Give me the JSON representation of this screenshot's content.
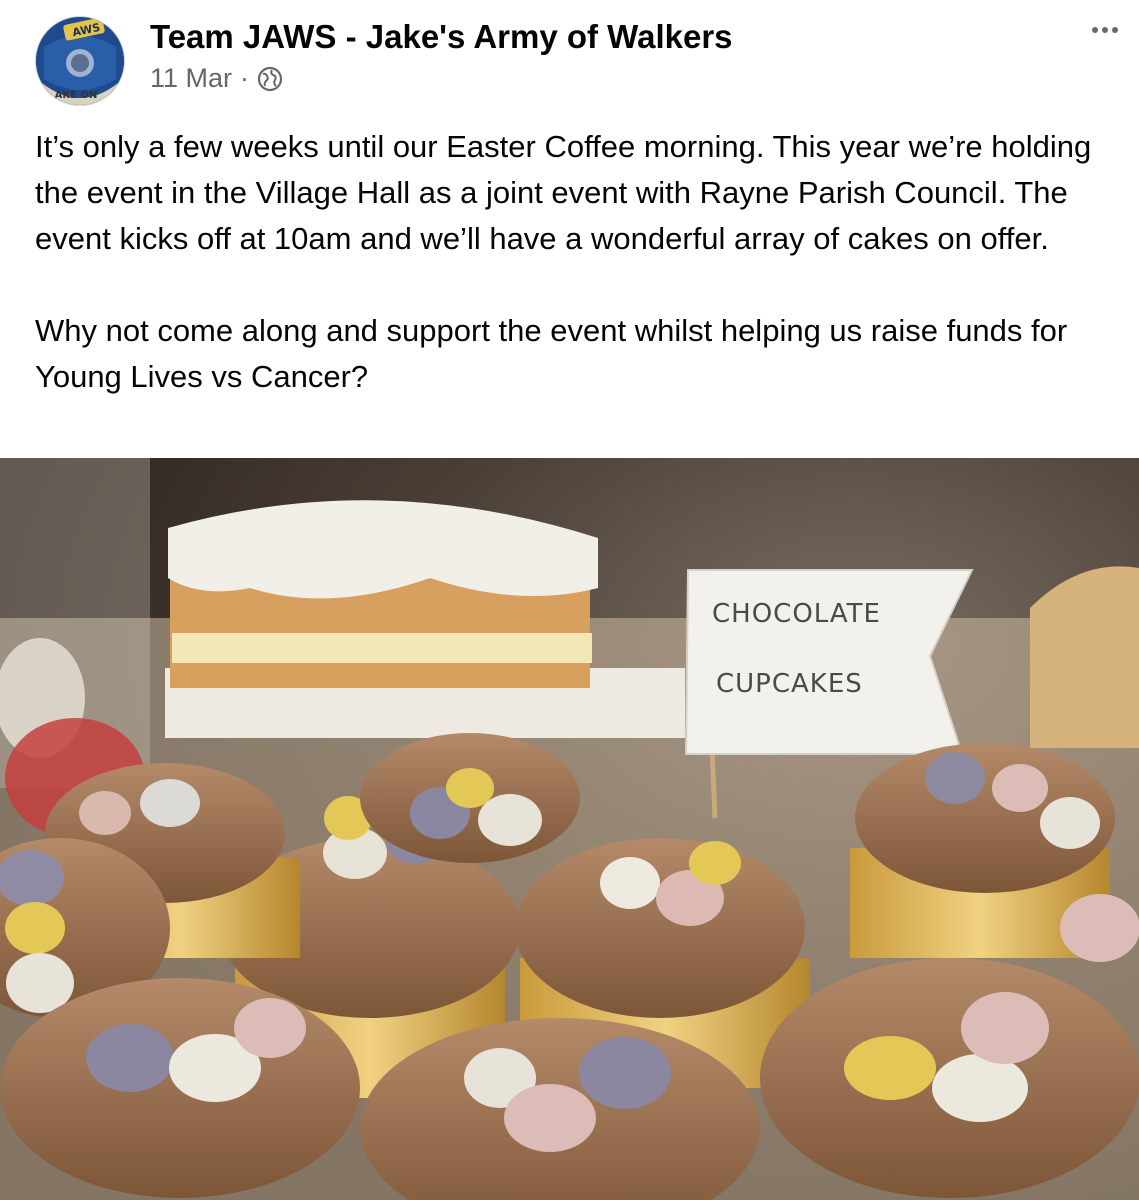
{
  "post": {
    "page_name": "Team JAWS - Jake's Army of Walkers",
    "date": "11 Mar",
    "separator": "·",
    "audience_icon": "globe-icon",
    "more_icon": "more-options-icon",
    "avatar_text": {
      "top": "AWS",
      "bottom": "AKE ON"
    },
    "paragraphs": [
      "It’s only a few weeks until our Easter Coffee morning. This year we’re holding the event in the Village Hall as a joint event with Rayne Parish Council. The event kicks off at 10am and we’ll have a wonderful array of cakes on offer.",
      "Why not come along and support the event whilst helping us raise funds for Young Lives vs Cancer?"
    ],
    "photo": {
      "flag_line1": "CHOCOLATE",
      "flag_line2": "CUPCAKES"
    }
  },
  "colors": {
    "text": "#050505",
    "secondary_text": "#65676b",
    "frosting": "#9c7455",
    "sponge": "#d9a05c",
    "icing": "#f1ede4"
  }
}
